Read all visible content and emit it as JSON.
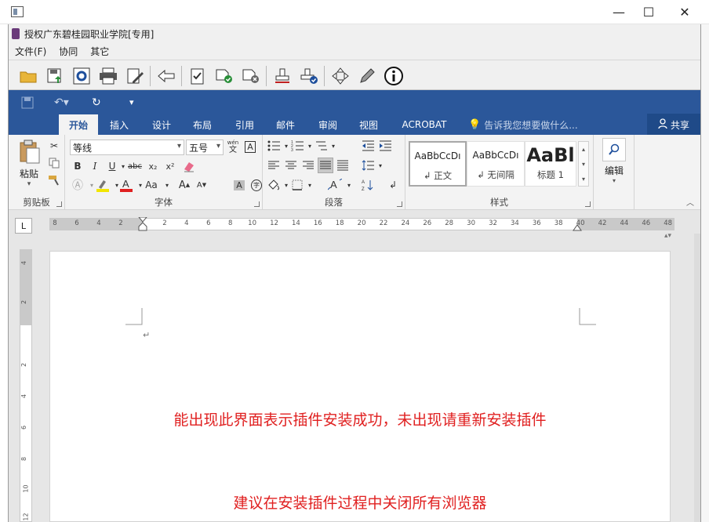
{
  "window": {
    "minimize": "—",
    "maximize": "☐",
    "close": "✕"
  },
  "app": {
    "title": "授权广东碧桂园职业学院[专用]"
  },
  "menu": [
    "文件(F)",
    "协同",
    "其它"
  ],
  "ribbon": {
    "tabs": [
      "开始",
      "插入",
      "设计",
      "布局",
      "引用",
      "邮件",
      "审阅",
      "视图",
      "ACROBAT"
    ],
    "active_tab": "开始",
    "tellme": "告诉我您想要做什么...",
    "share": "共享"
  },
  "clipboard": {
    "paste": "粘贴",
    "label": "剪贴板"
  },
  "font": {
    "name": "等线",
    "size": "五号",
    "label": "字体",
    "bold": "B",
    "italic": "I",
    "underline": "U",
    "strike": "abc",
    "sub": "x₂",
    "sup": "x²",
    "grow": "A",
    "shrink": "A",
    "case": "Aa",
    "phonetic": "wén",
    "phonetic_char": "文",
    "border_char": "A",
    "circle_char": "字"
  },
  "paragraph": {
    "label": "段落"
  },
  "styles": {
    "label": "样式",
    "items": [
      {
        "preview": "AaBbCcDı",
        "name": "↲ 正文"
      },
      {
        "preview": "AaBbCcDı",
        "name": "↲ 无间隔"
      },
      {
        "preview": "AaBl",
        "name": "标题 1"
      }
    ]
  },
  "editing": {
    "label": "编辑"
  },
  "ruler": {
    "tab_selector": "L",
    "h_left": [
      "8",
      "6",
      "4",
      "2"
    ],
    "h_main": [
      "2",
      "4",
      "6",
      "8",
      "10",
      "12",
      "14",
      "16",
      "18",
      "20",
      "22",
      "24",
      "26",
      "28",
      "30",
      "32",
      "34",
      "36",
      "38",
      "40",
      "42",
      "44",
      "46",
      "48"
    ],
    "v": [
      "4",
      "2",
      "2",
      "4",
      "6",
      "8",
      "10",
      "12"
    ]
  },
  "document": {
    "paragraph_mark": "↵",
    "line1": "能出现此界面表示插件安装成功，未出现请重新安装插件",
    "line2": "建议在安装插件过程中关闭所有浏览器"
  },
  "colors": {
    "ribbon": "#2b579a",
    "accent_text": "#e02020"
  }
}
